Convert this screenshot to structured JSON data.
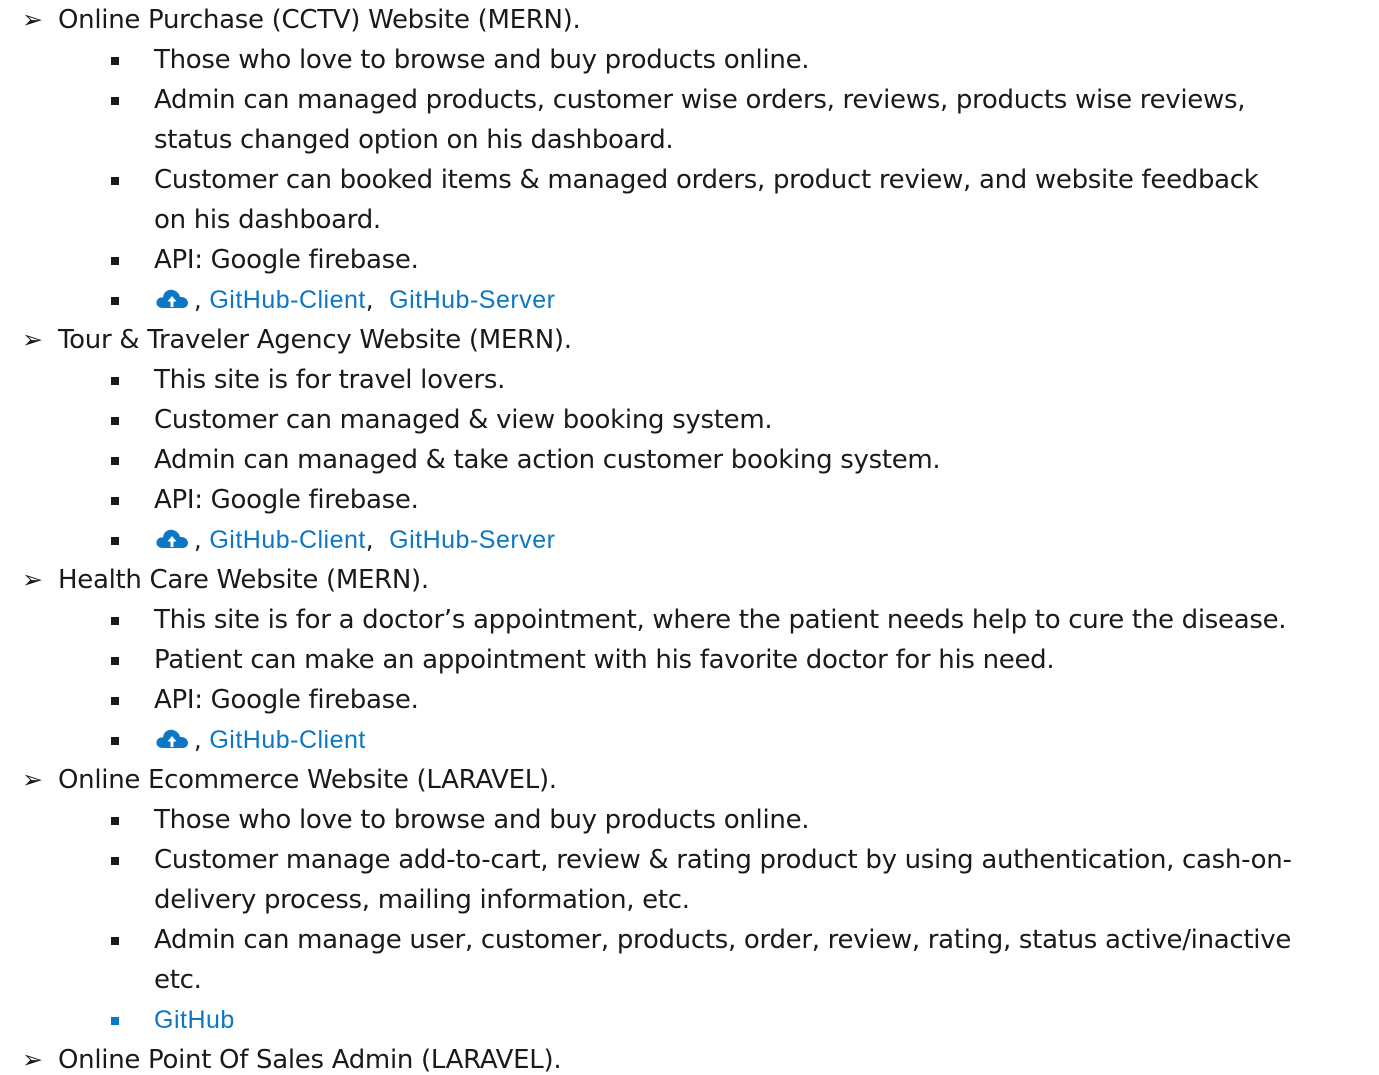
{
  "projects": [
    {
      "title": "Online Purchase (CCTV) Website (MERN).",
      "items": [
        [
          "Those who love to browse and buy products online."
        ],
        [
          "Admin can managed products, customer wise orders, reviews, products wise reviews,",
          "status changed option on his dashboard."
        ],
        [
          "Customer can booked items & managed orders, product review, and website feedback",
          "on his dashboard."
        ],
        [
          "API: Google firebase."
        ]
      ],
      "links": {
        "live_icon": "cloud-upload-icon",
        "separator": ",",
        "client": "GitHub-Client",
        "server": "GitHub-Server"
      }
    },
    {
      "title": "Tour & Traveler Agency Website (MERN).",
      "items": [
        [
          "This site is for travel lovers."
        ],
        [
          "Customer can managed & view booking system."
        ],
        [
          "Admin can managed & take action customer booking system."
        ],
        [
          "API: Google firebase."
        ]
      ],
      "links": {
        "live_icon": "cloud-upload-icon",
        "separator": ",",
        "client": "GitHub-Client",
        "server": "GitHub-Server"
      }
    },
    {
      "title": "Health Care Website (MERN).",
      "items": [
        [
          "This site is for a doctor’s appointment, where the patient needs help to cure the disease."
        ],
        [
          "Patient can make an appointment with his favorite doctor for his need."
        ],
        [
          "API: Google firebase."
        ]
      ],
      "links": {
        "live_icon": "cloud-upload-icon",
        "separator": ",",
        "client": "GitHub-Client"
      }
    },
    {
      "title": "Online Ecommerce Website (LARAVEL).",
      "items": [
        [
          "Those who love to browse and buy products online."
        ],
        [
          "Customer manage add-to-cart, review & rating product by using authentication, cash-on-",
          "delivery process, mailing information, etc."
        ],
        [
          "Admin can manage user, customer, products, order, review, rating, status active/inactive",
          "etc."
        ]
      ],
      "links": {
        "github": "GitHub"
      }
    },
    {
      "title": "Online Point Of Sales Admin (LARAVEL).",
      "items": []
    }
  ],
  "colors": {
    "text": "#1a1a1a",
    "link": "#0b77c5"
  },
  "icons": {
    "project_bullet": "arrow-bullet-icon",
    "item_bullet": "square-bullet-icon"
  }
}
